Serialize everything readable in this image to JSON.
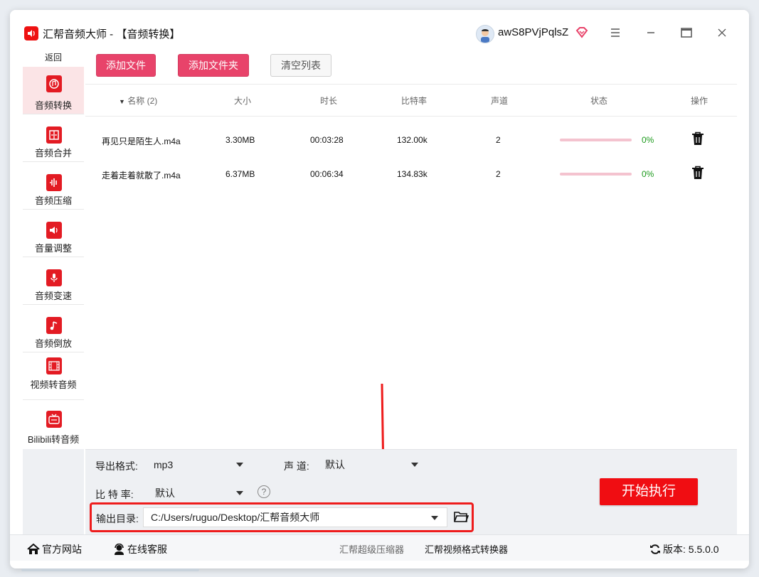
{
  "titlebar": {
    "app_name": "汇帮音频大师",
    "separator": " - ",
    "section": "【音频转换】",
    "username": "awS8PVjPqlsZ"
  },
  "sidebar": {
    "back_label": "返回",
    "items": [
      {
        "label": "音频转换",
        "icon": "audio-convert-icon",
        "active": true
      },
      {
        "label": "音频合并",
        "icon": "audio-merge-icon",
        "active": false
      },
      {
        "label": "音频压缩",
        "icon": "audio-compress-icon",
        "active": false
      },
      {
        "label": "音量调整",
        "icon": "volume-adjust-icon",
        "active": false
      },
      {
        "label": "音频变速",
        "icon": "audio-speed-icon",
        "active": false
      },
      {
        "label": "音频倒放",
        "icon": "audio-reverse-icon",
        "active": false
      },
      {
        "label": "视频转音频",
        "icon": "video-to-audio-icon",
        "active": false
      },
      {
        "label": "Bilibili转音频",
        "icon": "bilibili-tv-icon",
        "active": false
      }
    ]
  },
  "toolbar": {
    "add_file": "添加文件",
    "add_folder": "添加文件夹",
    "clear_list": "清空列表"
  },
  "table": {
    "headers": {
      "name": "名称 (2)",
      "size": "大小",
      "duration": "时长",
      "bitrate": "比特率",
      "channel": "声道",
      "status": "状态",
      "action": "操作"
    },
    "rows": [
      {
        "name": "再见只是陌生人.m4a",
        "size": "3.30MB",
        "duration": "00:03:28",
        "bitrate": "132.00k",
        "channel": "2",
        "progress": 0,
        "percent": "0%"
      },
      {
        "name": "走着走着就散了.m4a",
        "size": "6.37MB",
        "duration": "00:06:34",
        "bitrate": "134.83k",
        "channel": "2",
        "progress": 0,
        "percent": "0%"
      }
    ]
  },
  "settings": {
    "format_label": "导出格式:",
    "format_value": "mp3",
    "channel_label": "声 道:",
    "channel_value": "默认",
    "bitrate_label": "比 特 率:",
    "bitrate_value": "默认",
    "help": "?",
    "output_label": "输出目录:",
    "output_path": "C:/Users/ruguo/Desktop/汇帮音频大师",
    "start_button": "开始执行"
  },
  "footer": {
    "website": "官方网站",
    "support": "在线客服",
    "link1": "汇帮超级压缩器",
    "link2": "汇帮视频格式转换器",
    "version": "版本: 5.5.0.0"
  },
  "colors": {
    "accent": "#e8436a",
    "brand_red": "#e31b23",
    "start_button": "#f00d12",
    "highlight_box": "#ee1c1c",
    "success": "#1c9a1c"
  }
}
